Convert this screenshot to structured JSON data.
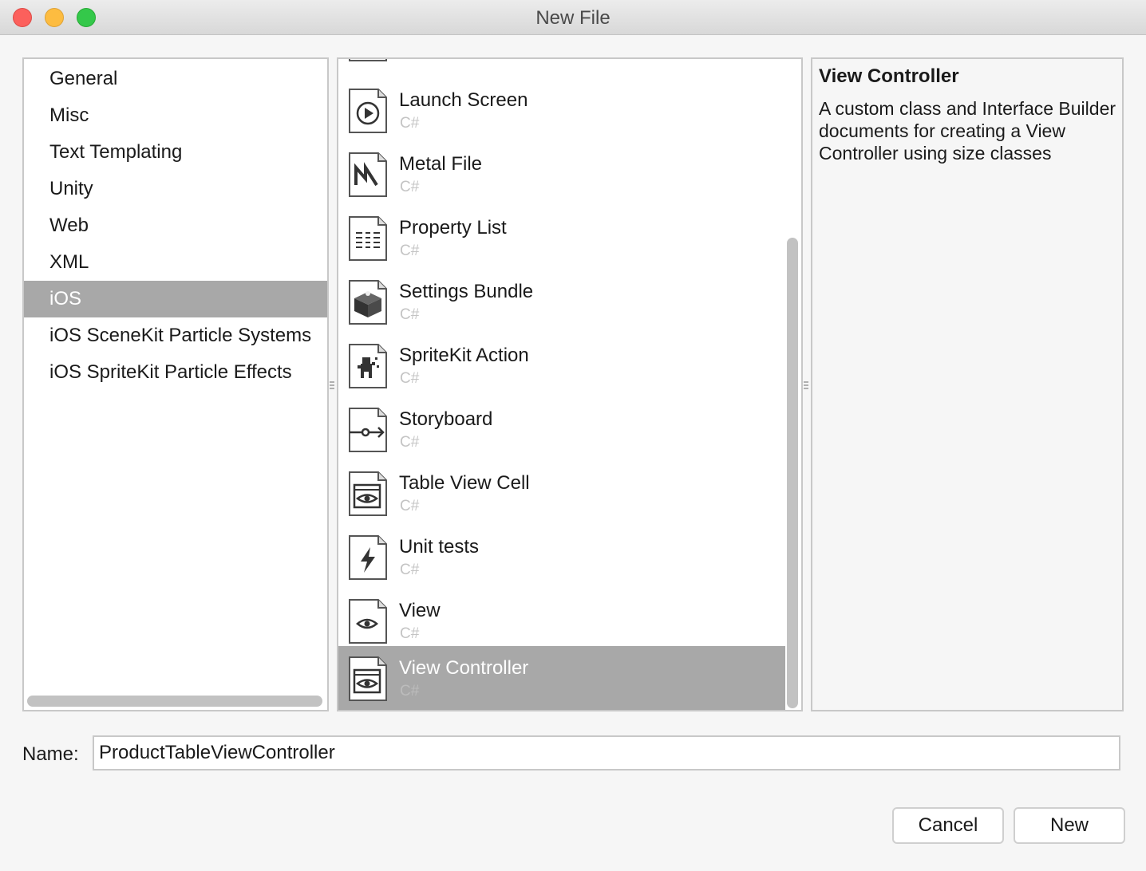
{
  "window": {
    "title": "New File"
  },
  "categories": [
    {
      "label": "General",
      "selected": false
    },
    {
      "label": "Misc",
      "selected": false
    },
    {
      "label": "Text Templating",
      "selected": false
    },
    {
      "label": "Unity",
      "selected": false
    },
    {
      "label": "Web",
      "selected": false
    },
    {
      "label": "XML",
      "selected": false
    },
    {
      "label": "iOS",
      "selected": true
    },
    {
      "label": "iOS SceneKit Particle Systems",
      "selected": false
    },
    {
      "label": "iOS SpriteKit Particle Effects",
      "selected": false
    }
  ],
  "templates": [
    {
      "name": "Launch Screen",
      "language": "C#",
      "icon": "play-icon",
      "selected": false
    },
    {
      "name": "Metal File",
      "language": "C#",
      "icon": "metal-icon",
      "selected": false
    },
    {
      "name": "Property List",
      "language": "C#",
      "icon": "list-icon",
      "selected": false
    },
    {
      "name": "Settings Bundle",
      "language": "C#",
      "icon": "bundle-icon",
      "selected": false
    },
    {
      "name": "SpriteKit Action",
      "language": "C#",
      "icon": "sprite-icon",
      "selected": false
    },
    {
      "name": "Storyboard",
      "language": "C#",
      "icon": "storyboard-icon",
      "selected": false
    },
    {
      "name": "Table View Cell",
      "language": "C#",
      "icon": "window-eye-icon",
      "selected": false
    },
    {
      "name": "Unit tests",
      "language": "C#",
      "icon": "lightning-icon",
      "selected": false
    },
    {
      "name": "View",
      "language": "C#",
      "icon": "eye-icon",
      "selected": false
    },
    {
      "name": "View Controller",
      "language": "C#",
      "icon": "window-eye-icon",
      "selected": true
    }
  ],
  "description": {
    "title": "View Controller",
    "text": "A custom class and Interface Builder documents for creating a View Controller using size classes"
  },
  "name_field": {
    "label": "Name:",
    "value": "ProductTableViewController"
  },
  "buttons": {
    "cancel": "Cancel",
    "new": "New"
  }
}
